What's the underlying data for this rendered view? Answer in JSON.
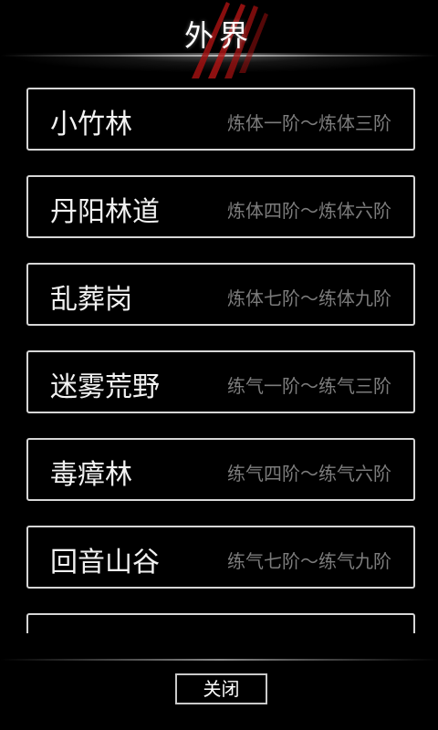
{
  "header": {
    "title": "外界"
  },
  "areas": [
    {
      "name": "小竹林",
      "range": "炼体一阶～炼体三阶"
    },
    {
      "name": "丹阳林道",
      "range": "炼体四阶～炼体六阶"
    },
    {
      "name": "乱葬岗",
      "range": "炼体七阶～练体九阶"
    },
    {
      "name": "迷雾荒野",
      "range": "练气一阶～练气三阶"
    },
    {
      "name": "毒瘴林",
      "range": "练气四阶～练气六阶"
    },
    {
      "name": "回音山谷",
      "range": "练气七阶～练气九阶"
    },
    {
      "name": "",
      "range": ""
    }
  ],
  "footer": {
    "close_label": "关闭"
  },
  "colors": {
    "accent_claw": "#a01010",
    "card_border": "#d6d6d6",
    "range_text": "#7c7c7c"
  }
}
